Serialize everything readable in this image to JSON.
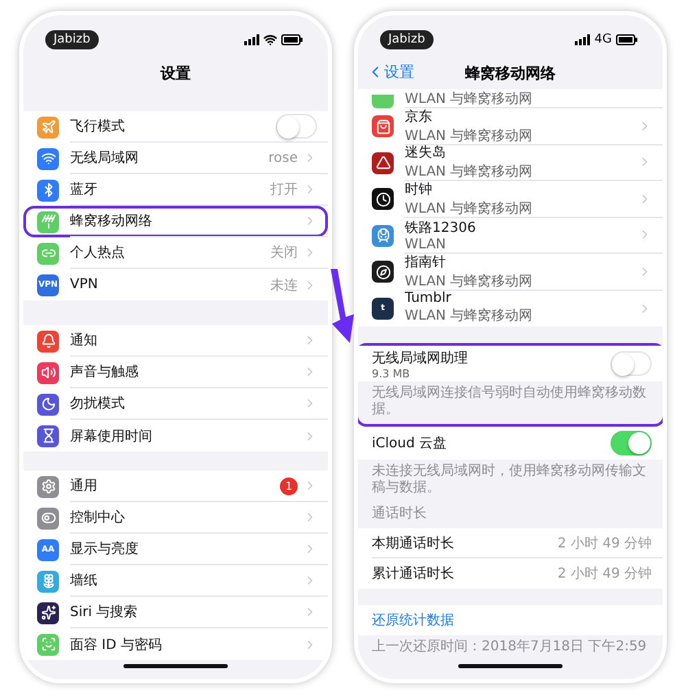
{
  "settings_screen": {
    "status_badge": "Jabizb",
    "title": "设置",
    "groups": [
      {
        "items": [
          {
            "label": "飞行模式",
            "kind": "toggle",
            "on": false,
            "highlighted": false
          },
          {
            "label": "无线局域网",
            "kind": "link",
            "value": "rose",
            "highlighted": false
          },
          {
            "label": "蓝牙",
            "kind": "link",
            "value": "打开",
            "highlighted": false
          },
          {
            "label": "蜂窝移动网络",
            "kind": "link",
            "highlighted": true
          },
          {
            "label": "个人热点",
            "kind": "link",
            "value": "关闭",
            "highlighted": false
          },
          {
            "label": "VPN",
            "kind": "link",
            "value": "未连",
            "icon_text": "VPN",
            "highlighted": false
          }
        ]
      },
      {
        "items": [
          {
            "label": "通知",
            "kind": "link",
            "highlighted": false
          },
          {
            "label": "声音与触感",
            "kind": "link",
            "highlighted": false
          },
          {
            "label": "勿扰模式",
            "kind": "link",
            "highlighted": false
          },
          {
            "label": "屏幕使用时间",
            "kind": "link",
            "highlighted": false
          }
        ]
      },
      {
        "items": [
          {
            "label": "通用",
            "kind": "link",
            "badge": "1",
            "highlighted": false
          },
          {
            "label": "控制中心",
            "kind": "link",
            "highlighted": false
          },
          {
            "label": "显示与亮度",
            "kind": "link",
            "icon_text": "AA",
            "highlighted": false
          },
          {
            "label": "墙纸",
            "kind": "link",
            "highlighted": false
          },
          {
            "label": "Siri 与搜索",
            "kind": "link",
            "highlighted": false
          },
          {
            "label": "面容 ID 与密码",
            "kind": "link",
            "highlighted": false
          }
        ]
      }
    ]
  },
  "cellular_screen": {
    "status_badge": "Jabizb",
    "network": "4G",
    "back": "设置",
    "title": "蜂窝移动网络",
    "apps": [
      {
        "kind": "partial",
        "subtitle": "WLAN 与蜂窝移动网"
      },
      {
        "kind": "app",
        "name": "京东",
        "subtitle": "WLAN 与蜂窝移动网"
      },
      {
        "kind": "app",
        "name": "迷失岛",
        "subtitle": "WLAN 与蜂窝移动网"
      },
      {
        "kind": "app",
        "name": "时钟",
        "subtitle": "WLAN 与蜂窝移动网"
      },
      {
        "kind": "app",
        "name": "铁路12306",
        "subtitle": "WLAN"
      },
      {
        "kind": "app",
        "name": "指南针",
        "subtitle": "WLAN 与蜂窝移动网"
      },
      {
        "kind": "app",
        "name": "Tumblr",
        "subtitle": "WLAN 与蜂窝移动网",
        "icon_text": "t"
      }
    ],
    "wifi_assist": {
      "label": "无线局域网助理",
      "detail": "9.3 MB",
      "on": false,
      "highlighted": true,
      "footer": "无线局域网连接信号弱时自动使用蜂窝移动数据。"
    },
    "icloud": {
      "label": "iCloud 云盘",
      "on": true,
      "footer": "未连接无线局域网时，使用蜂窝移动网传输文稿与数据。"
    },
    "call_time": {
      "header": "通话时长",
      "rows": [
        {
          "label": "本期通话时长",
          "value": "2 小时 49 分钟"
        },
        {
          "label": "累计通话时长",
          "value": "2 小时 49 分钟"
        }
      ]
    },
    "reset": {
      "link": "还原统计数据",
      "footer": "上一次还原时间：2018年7月18日 下午2:59"
    }
  }
}
